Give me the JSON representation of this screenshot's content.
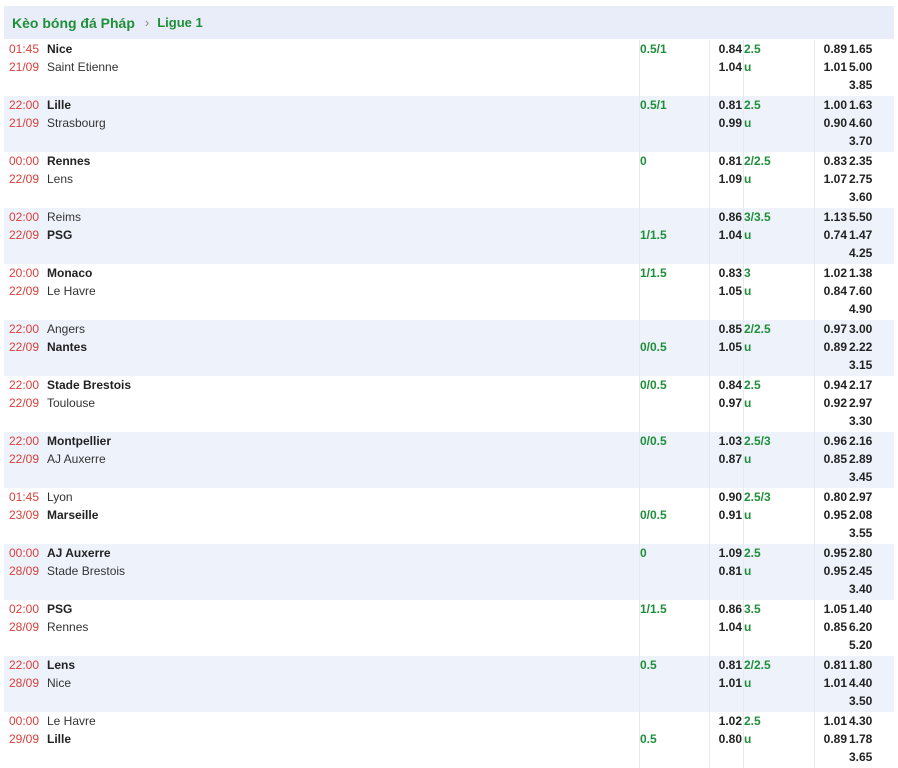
{
  "breadcrumb": {
    "main": "Kèo bóng đá Pháp",
    "separator": "›",
    "league": "Ligue 1"
  },
  "matches": [
    {
      "time": "01:45",
      "date": "21/09",
      "home": "Nice",
      "away": "Saint Etienne",
      "fav": "home",
      "handicap": "0.5/1",
      "ah_home": "0.84",
      "ah_away": "1.04",
      "ou_line": "2.5",
      "ou_label": "u",
      "over": "0.89",
      "under": "1.01",
      "x1": "1.65",
      "x2": "5.00",
      "xd": "3.85"
    },
    {
      "time": "22:00",
      "date": "21/09",
      "home": "Lille",
      "away": "Strasbourg",
      "fav": "home",
      "handicap": "0.5/1",
      "ah_home": "0.81",
      "ah_away": "0.99",
      "ou_line": "2.5",
      "ou_label": "u",
      "over": "1.00",
      "under": "0.90",
      "x1": "1.63",
      "x2": "4.60",
      "xd": "3.70"
    },
    {
      "time": "00:00",
      "date": "22/09",
      "home": "Rennes",
      "away": "Lens",
      "fav": "home",
      "handicap": "0",
      "ah_home": "0.81",
      "ah_away": "1.09",
      "ou_line": "2/2.5",
      "ou_label": "u",
      "over": "0.83",
      "under": "1.07",
      "x1": "2.35",
      "x2": "2.75",
      "xd": "3.60"
    },
    {
      "time": "02:00",
      "date": "22/09",
      "home": "Reims",
      "away": "PSG",
      "fav": "away",
      "handicap": "1/1.5",
      "ah_home": "0.86",
      "ah_away": "1.04",
      "ou_line": "3/3.5",
      "ou_label": "u",
      "over": "1.13",
      "under": "0.74",
      "x1": "5.50",
      "x2": "1.47",
      "xd": "4.25"
    },
    {
      "time": "20:00",
      "date": "22/09",
      "home": "Monaco",
      "away": "Le Havre",
      "fav": "home",
      "handicap": "1/1.5",
      "ah_home": "0.83",
      "ah_away": "1.05",
      "ou_line": "3",
      "ou_label": "u",
      "over": "1.02",
      "under": "0.84",
      "x1": "1.38",
      "x2": "7.60",
      "xd": "4.90"
    },
    {
      "time": "22:00",
      "date": "22/09",
      "home": "Angers",
      "away": "Nantes",
      "fav": "away",
      "handicap": "0/0.5",
      "ah_home": "0.85",
      "ah_away": "1.05",
      "ou_line": "2/2.5",
      "ou_label": "u",
      "over": "0.97",
      "under": "0.89",
      "x1": "3.00",
      "x2": "2.22",
      "xd": "3.15"
    },
    {
      "time": "22:00",
      "date": "22/09",
      "home": "Stade Brestois",
      "away": "Toulouse",
      "fav": "home",
      "handicap": "0/0.5",
      "ah_home": "0.84",
      "ah_away": "0.97",
      "ou_line": "2.5",
      "ou_label": "u",
      "over": "0.94",
      "under": "0.92",
      "x1": "2.17",
      "x2": "2.97",
      "xd": "3.30"
    },
    {
      "time": "22:00",
      "date": "22/09",
      "home": "Montpellier",
      "away": "AJ Auxerre",
      "fav": "home",
      "handicap": "0/0.5",
      "ah_home": "1.03",
      "ah_away": "0.87",
      "ou_line": "2.5/3",
      "ou_label": "u",
      "over": "0.96",
      "under": "0.85",
      "x1": "2.16",
      "x2": "2.89",
      "xd": "3.45"
    },
    {
      "time": "01:45",
      "date": "23/09",
      "home": "Lyon",
      "away": "Marseille",
      "fav": "away",
      "handicap": "0/0.5",
      "ah_home": "0.90",
      "ah_away": "0.91",
      "ou_line": "2.5/3",
      "ou_label": "u",
      "over": "0.80",
      "under": "0.95",
      "x1": "2.97",
      "x2": "2.08",
      "xd": "3.55"
    },
    {
      "time": "00:00",
      "date": "28/09",
      "home": "AJ Auxerre",
      "away": "Stade Brestois",
      "fav": "home",
      "handicap": "0",
      "ah_home": "1.09",
      "ah_away": "0.81",
      "ou_line": "2.5",
      "ou_label": "u",
      "over": "0.95",
      "under": "0.95",
      "x1": "2.80",
      "x2": "2.45",
      "xd": "3.40"
    },
    {
      "time": "02:00",
      "date": "28/09",
      "home": "PSG",
      "away": "Rennes",
      "fav": "home",
      "handicap": "1/1.5",
      "ah_home": "0.86",
      "ah_away": "1.04",
      "ou_line": "3.5",
      "ou_label": "u",
      "over": "1.05",
      "under": "0.85",
      "x1": "1.40",
      "x2": "6.20",
      "xd": "5.20"
    },
    {
      "time": "22:00",
      "date": "28/09",
      "home": "Lens",
      "away": "Nice",
      "fav": "home",
      "handicap": "0.5",
      "ah_home": "0.81",
      "ah_away": "1.01",
      "ou_line": "2/2.5",
      "ou_label": "u",
      "over": "0.81",
      "under": "1.01",
      "x1": "1.80",
      "x2": "4.40",
      "xd": "3.50"
    },
    {
      "time": "00:00",
      "date": "29/09",
      "home": "Le Havre",
      "away": "Lille",
      "fav": "away",
      "handicap": "0.5",
      "ah_home": "1.02",
      "ah_away": "0.80",
      "ou_line": "2.5",
      "ou_label": "u",
      "over": "1.01",
      "under": "0.89",
      "x1": "4.30",
      "x2": "1.78",
      "xd": "3.65"
    }
  ],
  "colors": {
    "accent_green": "#1f8f3a",
    "time_red": "#d9413b",
    "header_bg": "#e8edf9",
    "row_alt_bg": "#eef3fb"
  }
}
